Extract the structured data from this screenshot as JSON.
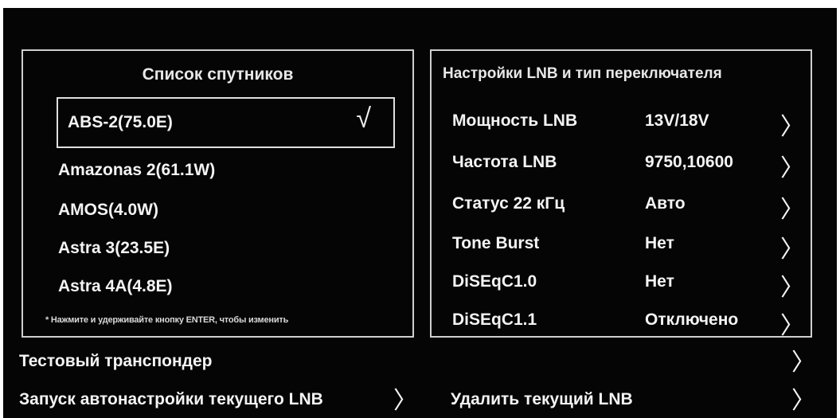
{
  "satellites": {
    "title": "Список спутников",
    "items": [
      {
        "name": "ABS-2(75.0E)",
        "selected": true
      },
      {
        "name": "Amazonas 2(61.1W)",
        "selected": false
      },
      {
        "name": "AMOS(4.0W)",
        "selected": false
      },
      {
        "name": "Astra 3(23.5E)",
        "selected": false
      },
      {
        "name": "Astra 4A(4.8E)",
        "selected": false
      }
    ],
    "check_mark": "√",
    "note": "* Нажмите и удерживайте кнопку ENTER, чтобы изменить"
  },
  "lnb": {
    "title": "Настройки LNB и тип переключателя",
    "rows": [
      {
        "label": "Мощность LNB",
        "value": "13V/18V"
      },
      {
        "label": "Частота LNB",
        "value": "9750,10600"
      },
      {
        "label": "Статус 22 кГц",
        "value": "Авто"
      },
      {
        "label": "Tone Burst",
        "value": "Нет"
      },
      {
        "label": "DiSEqC1.0",
        "value": "Нет"
      },
      {
        "label": "DiSEqC1.1",
        "value": "Отключено"
      }
    ],
    "chevron": "〉"
  },
  "bottom": {
    "test_transponder": "Тестовый транспондер",
    "autoscan": "Запуск автонастройки текущего LNB",
    "delete_lnb": "Удалить текущий LNB",
    "chevron": "〉"
  },
  "colors": {
    "background": "#050505",
    "text": "#f4f4f4",
    "border": "#cfcfcf"
  }
}
